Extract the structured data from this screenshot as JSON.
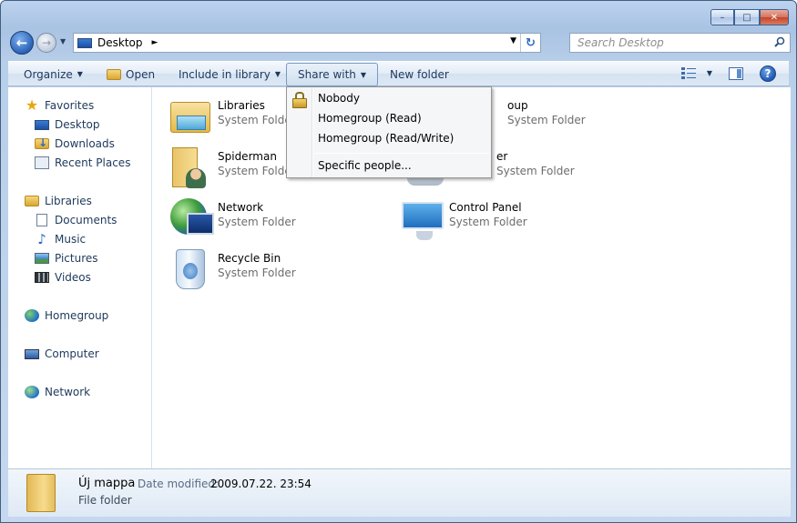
{
  "window": {
    "caption": {
      "minimize": "–",
      "maximize": "□",
      "close": "✕"
    }
  },
  "nav": {
    "back": "←",
    "forward": "→",
    "history": "▼",
    "address": {
      "location": "Desktop",
      "separator": "►",
      "dropdown": "▼",
      "refresh": "↻"
    },
    "search": {
      "placeholder": "Search Desktop"
    }
  },
  "toolbar": {
    "organize": "Organize",
    "open": "Open",
    "include_in_library": "Include in library",
    "share_with": "Share with",
    "new_folder": "New folder",
    "dropdown_arrow": "▼",
    "help": "?"
  },
  "share_menu": {
    "items": [
      "Nobody",
      "Homegroup (Read)",
      "Homegroup (Read/Write)"
    ],
    "extra": "Specific people..."
  },
  "sidebar": {
    "favorites": "Favorites",
    "favorites_items": [
      "Desktop",
      "Downloads",
      "Recent Places"
    ],
    "libraries": "Libraries",
    "libraries_items": [
      "Documents",
      "Music",
      "Pictures",
      "Videos"
    ],
    "homegroup": "Homegroup",
    "computer": "Computer",
    "network": "Network"
  },
  "content": {
    "items": [
      {
        "name": "Libraries",
        "type": "System Folder"
      },
      {
        "name": "oup",
        "type": "System Folder"
      },
      {
        "name": "Spiderman",
        "type": "System Folder"
      },
      {
        "name": "er",
        "type": "System Folder"
      },
      {
        "name": "Network",
        "type": "System Folder"
      },
      {
        "name": "Control Panel",
        "type": "System Folder"
      },
      {
        "name": "Recycle Bin",
        "type": "System Folder"
      }
    ]
  },
  "details": {
    "name": "Új mappa",
    "date_label": "Date modified:",
    "date_value": "2009.07.22. 23:54",
    "type": "File folder"
  },
  "colors": {
    "accent": "#1e395b",
    "frame": "#a9c3e4"
  }
}
